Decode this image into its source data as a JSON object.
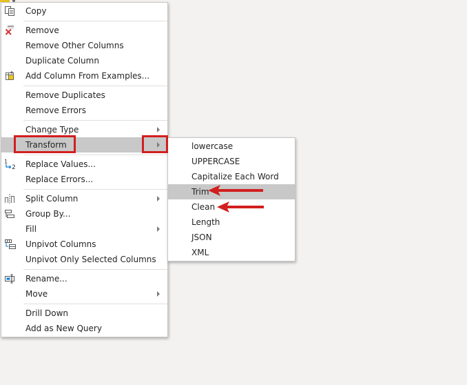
{
  "main_menu": {
    "items": [
      {
        "label": "Copy",
        "icon": "copy-icon"
      },
      {
        "label": "Remove",
        "icon": "remove-icon"
      },
      {
        "label": "Remove Other Columns"
      },
      {
        "label": "Duplicate Column"
      },
      {
        "label": "Add Column From Examples...",
        "icon": "add-column-from-examples-icon"
      },
      {
        "label": "Remove Duplicates"
      },
      {
        "label": "Remove Errors"
      },
      {
        "label": "Change Type",
        "has_submenu": true
      },
      {
        "label": "Transform",
        "has_submenu": true,
        "highlighted": true
      },
      {
        "label": "Replace Values...",
        "icon": "replace-values-icon"
      },
      {
        "label": "Replace Errors..."
      },
      {
        "label": "Split Column",
        "has_submenu": true,
        "icon": "split-column-icon"
      },
      {
        "label": "Group By...",
        "icon": "group-by-icon"
      },
      {
        "label": "Fill",
        "has_submenu": true
      },
      {
        "label": "Unpivot Columns",
        "icon": "unpivot-columns-icon"
      },
      {
        "label": "Unpivot Only Selected Columns"
      },
      {
        "label": "Rename...",
        "icon": "rename-icon"
      },
      {
        "label": "Move",
        "has_submenu": true
      },
      {
        "label": "Drill Down"
      },
      {
        "label": "Add as New Query"
      }
    ]
  },
  "transform_submenu": {
    "items": [
      {
        "label": "lowercase"
      },
      {
        "label": "UPPERCASE"
      },
      {
        "label": "Capitalize Each Word"
      },
      {
        "label": "Trim",
        "highlighted": true
      },
      {
        "label": "Clean"
      },
      {
        "label": "Length"
      },
      {
        "label": "JSON"
      },
      {
        "label": "XML"
      }
    ]
  },
  "annotation_color": "#d21f1f",
  "highlight_color": "#c8c8c8"
}
